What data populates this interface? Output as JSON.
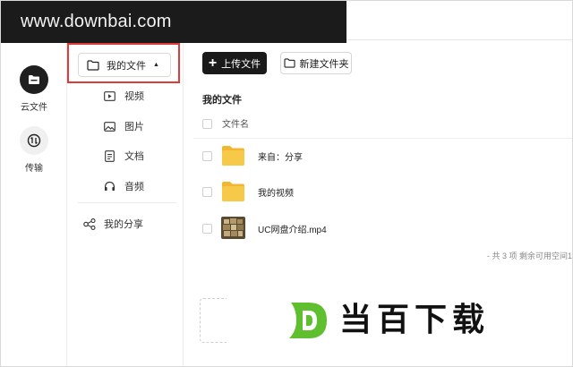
{
  "watermark": {
    "site": "www.downbai.com",
    "logo_text": "当百下载"
  },
  "rail": {
    "items": [
      {
        "label": "云文件",
        "icon": "folder-icon",
        "active": true
      },
      {
        "label": "传输",
        "icon": "transfer-icon",
        "active": false
      }
    ]
  },
  "sidebar": {
    "root": {
      "label": "我的文件",
      "icon": "folder-outline-icon",
      "expanded": true
    },
    "categories": [
      {
        "label": "视频",
        "icon": "video-icon"
      },
      {
        "label": "图片",
        "icon": "image-icon"
      },
      {
        "label": "文档",
        "icon": "document-icon"
      },
      {
        "label": "音频",
        "icon": "headphones-icon"
      }
    ],
    "share": {
      "label": "我的分享",
      "icon": "share-icon"
    }
  },
  "toolbar": {
    "upload_label": "上传文件",
    "new_folder_label": "新建文件夹"
  },
  "main": {
    "breadcrumb": "我的文件",
    "column_header": "文件名",
    "files": [
      {
        "name": "来自：分享",
        "type": "folder"
      },
      {
        "name": "我的视频",
        "type": "folder"
      },
      {
        "name": "UC网盘介绍.mp4",
        "type": "video"
      }
    ],
    "footer_text": "- 共 3 项 剩余可用空间1"
  },
  "colors": {
    "accent_dark": "#1a1a1a",
    "folder_yellow": "#f7c23a",
    "highlight_red": "#e03a3a",
    "logo_green": "#5fbf2f"
  }
}
